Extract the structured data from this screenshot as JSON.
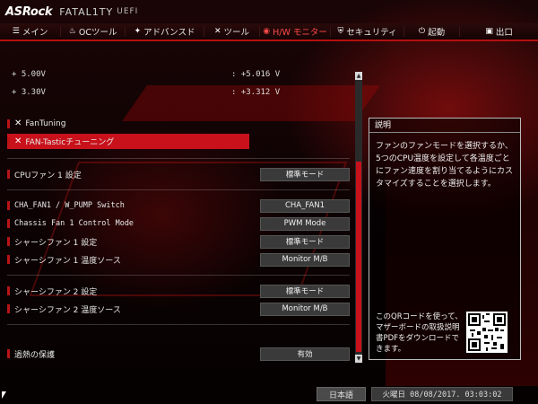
{
  "header": {
    "logo": "ASRock",
    "subbrand": "FATAL1TY",
    "uefi": "UEFI"
  },
  "nav": [
    {
      "label": "メイン",
      "icon": "list-icon",
      "glyph": "☰",
      "active": false
    },
    {
      "label": "OCツール",
      "icon": "flame-icon",
      "glyph": "♨",
      "active": false
    },
    {
      "label": "アドバンスド",
      "icon": "star-icon",
      "glyph": "✦",
      "active": false
    },
    {
      "label": "ツール",
      "icon": "wrench-icon",
      "glyph": "✕",
      "active": false
    },
    {
      "label": "H/W モニター",
      "icon": "monitor-icon",
      "glyph": "◉",
      "active": true
    },
    {
      "label": "セキュリティ",
      "icon": "shield-icon",
      "glyph": "⛨",
      "active": false
    },
    {
      "label": "起動",
      "icon": "power-icon",
      "glyph": "⏻",
      "active": false
    },
    {
      "label": "出口",
      "icon": "exit-icon",
      "glyph": "▣",
      "active": false
    }
  ],
  "voltages": [
    {
      "label": "+ 5.00V",
      "value": ": +5.016 V"
    },
    {
      "label": "+ 3.30V",
      "value": ": +3.312 V"
    }
  ],
  "menu": [
    {
      "label": "FanTuning"
    },
    {
      "label": "FAN-Tasticチューニング"
    }
  ],
  "options": [
    {
      "label": "CPUファン 1 設定",
      "value": "標準モード"
    },
    {
      "label": "CHA_FAN1 / W_PUMP Switch",
      "value": "CHA_FAN1"
    },
    {
      "label": "Chassis Fan 1 Control Mode",
      "value": "PWM Mode"
    },
    {
      "label": "シャーシファン 1 設定",
      "value": "標準モード"
    },
    {
      "label": "シャーシファン 1 温度ソース",
      "value": "Monitor M/B"
    },
    {
      "label": "シャーシファン 2 設定",
      "value": "標準モード"
    },
    {
      "label": "シャーシファン 2 温度ソース",
      "value": "Monitor M/B"
    },
    {
      "label": "過熱の保護",
      "value": "有効"
    }
  ],
  "description": {
    "title": "説明",
    "text": "ファンのファンモードを選択するか、5つのCPU温度を設定して各温度ごとにファン速度を割り当てるようにカスタマイズすることを選択します。",
    "qr_text": "このQRコードを使って、マザーボードの取扱説明書PDFをダウンロードできます。"
  },
  "footer": {
    "language": "日本語",
    "datetime": "火曜日 08/08/2017. 03:03:02"
  }
}
